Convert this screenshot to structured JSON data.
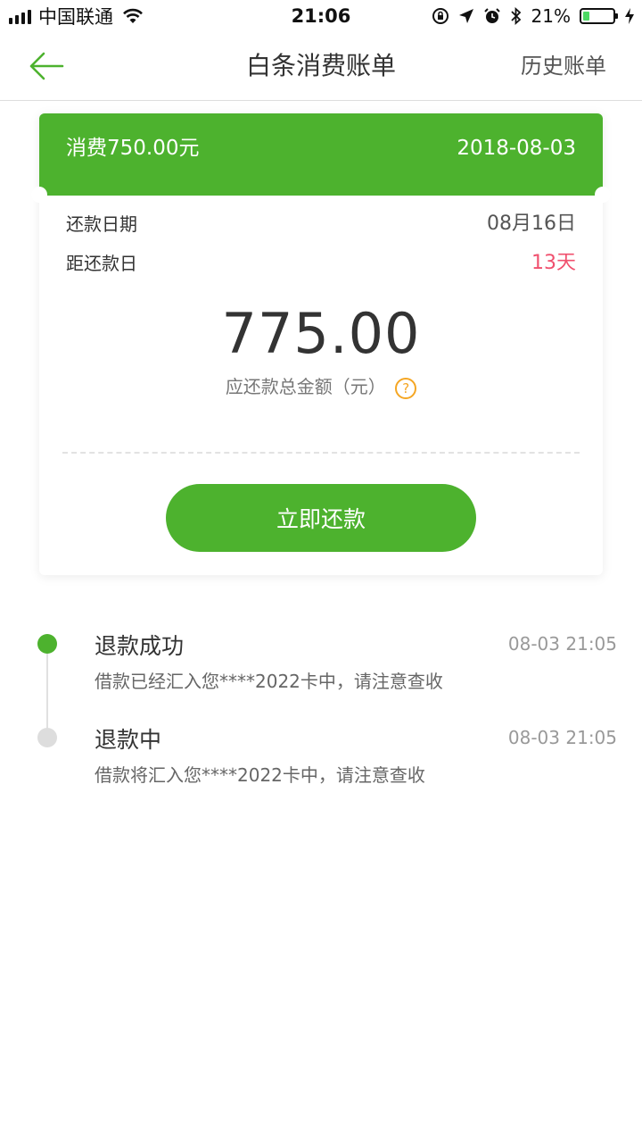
{
  "status_bar": {
    "carrier": "中国联通",
    "time": "21:06",
    "battery_percent": "21%",
    "battery_level": 0.21,
    "icons": [
      "signal-icon",
      "wifi-icon",
      "orientation-lock-icon",
      "location-icon",
      "alarm-icon",
      "bluetooth-icon",
      "battery-icon",
      "charging-icon"
    ]
  },
  "nav": {
    "back_icon": "back-arrow-icon",
    "title": "白条消费账单",
    "right_label": "历史账单"
  },
  "bill": {
    "consumption": "消费750.00元",
    "date": "2018-08-03",
    "repay_date_label": "还款日期",
    "repay_date_value": "08月16日",
    "days_left_label": "距还款日",
    "days_left_value": "13天",
    "total_amount": "775.00",
    "total_amount_label": "应还款总金额（元）",
    "help_icon": "question-icon",
    "pay_button": "立即还款"
  },
  "timeline": [
    {
      "title": "退款成功",
      "time": "08-03 21:05",
      "desc": "借款已经汇入您****2022卡中，请注意查收",
      "status": "done"
    },
    {
      "title": "退款中",
      "time": "08-03 21:05",
      "desc": "借款将汇入您****2022卡中，请注意查收",
      "status": "pending"
    }
  ],
  "colors": {
    "accent": "#4db22e",
    "warning": "#f0506e",
    "help": "#f5a623",
    "pending_dot": "#dddddd"
  }
}
